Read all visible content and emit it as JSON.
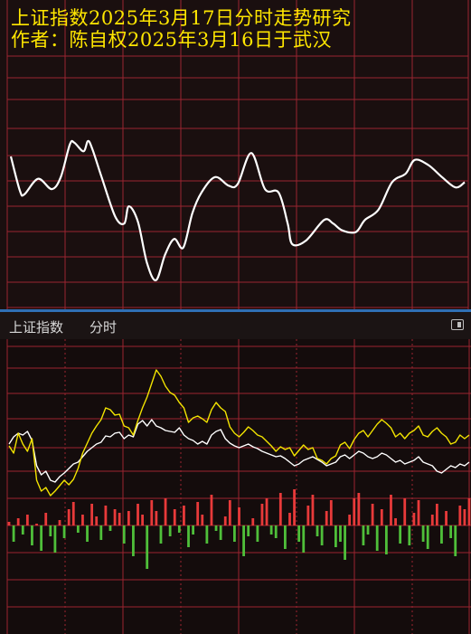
{
  "title": {
    "line1": "上证指数2025年3月17日分时走势研究",
    "line2": "作者：陈自权2025年3月16日于武汉"
  },
  "header": {
    "index_name": "上证指数",
    "tab_label": "分时"
  },
  "colors": {
    "grid": "#9b2430",
    "forecast_line": "#ffffff",
    "index_line": "#f2e300",
    "avg_line": "#ffffff",
    "volume_up": "#e83a3a",
    "volume_down": "#4fbf3a",
    "divider": "#2f6fb5",
    "title_text": "#ffe600"
  },
  "chart_data": [
    {
      "type": "line",
      "title": "",
      "xlabel": "",
      "ylabel": "",
      "grid": true,
      "ylim": [
        0,
        100
      ],
      "xlim": [
        0,
        100
      ],
      "series": [
        {
          "x": [
            0,
            2,
            3,
            6,
            9,
            11,
            13,
            14,
            16,
            17,
            18,
            20,
            23,
            25,
            26,
            28,
            30,
            32,
            34,
            36,
            38,
            40,
            42,
            45,
            48,
            50,
            53,
            56,
            59,
            61,
            62,
            65,
            69,
            71,
            73,
            76,
            78,
            81,
            84,
            87,
            89,
            92,
            95,
            98,
            100
          ],
          "values": [
            50,
            30,
            28,
            37,
            31,
            38,
            57,
            58,
            53,
            59,
            54,
            38,
            15,
            11,
            21,
            12,
            -12,
            -22,
            -7,
            2,
            -3,
            17,
            29,
            38,
            33,
            34,
            52,
            31,
            29,
            11,
            -1,
            1,
            13,
            11,
            7,
            6,
            13,
            19,
            35,
            40,
            48,
            45,
            38,
            32,
            35
          ]
        }
      ]
    },
    {
      "type": "line",
      "title": "",
      "xlabel": "",
      "ylabel": "",
      "grid": true,
      "ylim": [
        -100,
        100
      ],
      "xlim": [
        0,
        100
      ],
      "series": [
        {
          "x": [
            0,
            1,
            2,
            3,
            4,
            5,
            6,
            7,
            8,
            9,
            10,
            11,
            12,
            13,
            14,
            15,
            16,
            17,
            18,
            19,
            20,
            21,
            22,
            23,
            24,
            25,
            26,
            27,
            28,
            29,
            30,
            31,
            32,
            33,
            34,
            35,
            36,
            37,
            38,
            39,
            40,
            41,
            42,
            43,
            44,
            45,
            46,
            47,
            48,
            49,
            50,
            51,
            52,
            53,
            54,
            55,
            56,
            57,
            58,
            59,
            60,
            61,
            62,
            63,
            64,
            65,
            66,
            67,
            68,
            69,
            70,
            71,
            72,
            73,
            74,
            75,
            76,
            77,
            78,
            79,
            80,
            81,
            82,
            83,
            84,
            85,
            86,
            87,
            88,
            89,
            90,
            91,
            92,
            93,
            94,
            95,
            96,
            97,
            98,
            99,
            100
          ],
          "values": [
            58,
            50,
            72,
            60,
            52,
            66,
            20,
            8,
            12,
            3,
            8,
            14,
            20,
            15,
            21,
            33,
            50,
            61,
            72,
            80,
            87,
            100,
            98,
            92,
            93,
            80,
            78,
            70,
            86,
            100,
            112,
            127,
            142,
            135,
            124,
            117,
            114,
            106,
            100,
            84,
            89,
            91,
            88,
            84,
            98,
            106,
            100,
            96,
            79,
            72,
            68,
            73,
            79,
            75,
            70,
            68,
            63,
            58,
            52,
            57,
            54,
            56,
            47,
            53,
            59,
            54,
            56,
            44,
            42,
            38,
            44,
            47,
            59,
            62,
            55,
            65,
            72,
            75,
            68,
            75,
            82,
            87,
            83,
            78,
            68,
            72,
            66,
            72,
            75,
            80,
            70,
            68,
            74,
            78,
            72,
            68,
            60,
            62,
            70,
            66,
            70
          ]
        },
        {
          "x": [
            0,
            1,
            2,
            3,
            4,
            5,
            6,
            7,
            8,
            9,
            10,
            11,
            12,
            13,
            14,
            15,
            16,
            17,
            18,
            19,
            20,
            21,
            22,
            23,
            24,
            25,
            26,
            27,
            28,
            29,
            30,
            31,
            32,
            33,
            34,
            35,
            36,
            37,
            38,
            39,
            40,
            41,
            42,
            43,
            44,
            45,
            46,
            47,
            48,
            49,
            50,
            51,
            52,
            53,
            54,
            55,
            56,
            57,
            58,
            59,
            60,
            61,
            62,
            63,
            64,
            65,
            66,
            67,
            68,
            69,
            70,
            71,
            72,
            73,
            74,
            75,
            76,
            77,
            78,
            79,
            80,
            81,
            82,
            83,
            84,
            85,
            86,
            87,
            88,
            89,
            90,
            91,
            92,
            93,
            94,
            95,
            96,
            97,
            98,
            99,
            100
          ],
          "values": [
            60,
            68,
            72,
            70,
            74,
            64,
            36,
            26,
            30,
            20,
            18,
            24,
            28,
            33,
            38,
            40,
            46,
            52,
            56,
            60,
            62,
            69,
            68,
            72,
            73,
            66,
            70,
            68,
            82,
            86,
            80,
            87,
            80,
            78,
            75,
            74,
            73,
            78,
            70,
            66,
            64,
            60,
            63,
            60,
            70,
            74,
            76,
            66,
            61,
            58,
            56,
            58,
            60,
            57,
            55,
            52,
            50,
            48,
            46,
            47,
            44,
            40,
            36,
            38,
            42,
            44,
            46,
            43,
            40,
            36,
            38,
            40,
            46,
            48,
            44,
            48,
            52,
            50,
            46,
            44,
            46,
            50,
            48,
            44,
            40,
            42,
            38,
            40,
            42,
            46,
            40,
            38,
            36,
            30,
            28,
            32,
            36,
            34,
            38,
            36,
            40
          ]
        },
        {
          "type": "bar",
          "x": [
            0,
            1,
            2,
            3,
            4,
            5,
            6,
            7,
            8,
            9,
            10,
            11,
            12,
            13,
            14,
            15,
            16,
            17,
            18,
            19,
            20,
            21,
            22,
            23,
            24,
            25,
            26,
            27,
            28,
            29,
            30,
            31,
            32,
            33,
            34,
            35,
            36,
            37,
            38,
            39,
            40,
            41,
            42,
            43,
            44,
            45,
            46,
            47,
            48,
            49,
            50,
            51,
            52,
            53,
            54,
            55,
            56,
            57,
            58,
            59,
            60,
            61,
            62,
            63,
            64,
            65,
            66,
            67,
            68,
            69,
            70,
            71,
            72,
            73,
            74,
            75,
            76,
            77,
            78,
            79,
            80,
            81,
            82,
            83,
            84,
            85,
            86,
            87,
            88,
            89,
            90,
            91,
            92,
            93,
            94,
            95,
            96,
            97,
            98,
            99,
            100
          ],
          "values": [
            4,
            -18,
            8,
            -10,
            12,
            -22,
            2,
            -28,
            14,
            -12,
            -30,
            6,
            -14,
            18,
            26,
            -8,
            12,
            -18,
            24,
            10,
            -16,
            22,
            -6,
            18,
            14,
            -20,
            16,
            -34,
            24,
            12,
            -48,
            28,
            16,
            -20,
            30,
            -12,
            18,
            -8,
            22,
            -24,
            -10,
            26,
            12,
            -20,
            34,
            -6,
            -16,
            10,
            28,
            -18,
            20,
            -34,
            -12,
            8,
            -18,
            24,
            30,
            -10,
            -14,
            36,
            -26,
            14,
            40,
            -18,
            -30,
            22,
            34,
            -12,
            -22,
            16,
            28,
            -24,
            -18,
            -38,
            12,
            30,
            36,
            -22,
            -10,
            24,
            -28,
            18,
            -32,
            34,
            8,
            -20,
            30,
            -22,
            14,
            28,
            -18,
            -26,
            12,
            24,
            -20,
            16,
            -14,
            -34,
            22,
            18,
            30
          ]
        }
      ]
    }
  ]
}
